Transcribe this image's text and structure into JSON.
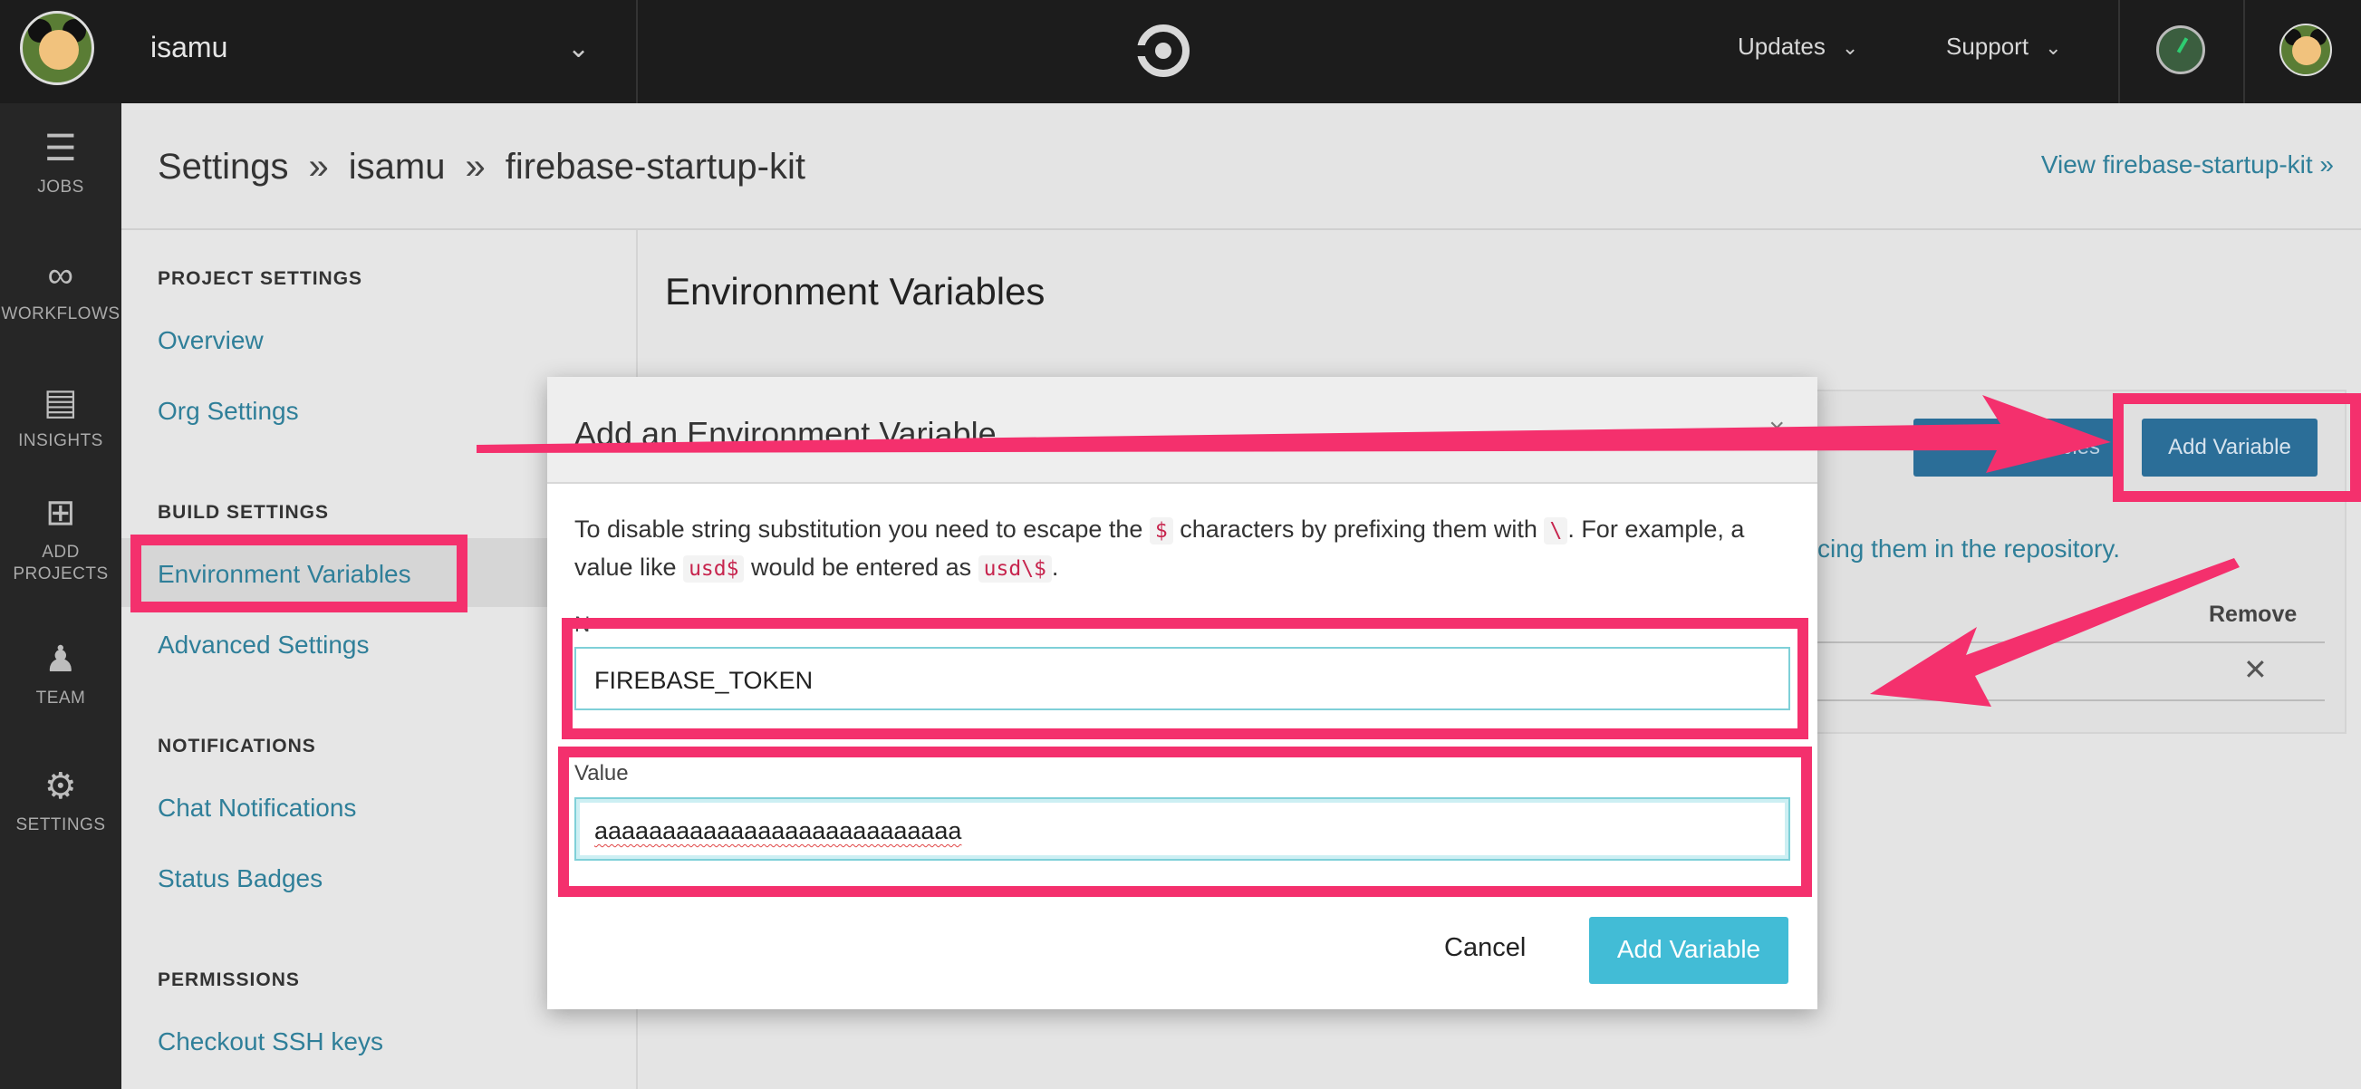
{
  "topbar": {
    "org_name": "isamu",
    "nav_updates": "Updates",
    "nav_support": "Support",
    "icons": [
      "org-avatar",
      "chevron-down-icon",
      "circleci-logo",
      "status-icon",
      "user-avatar"
    ]
  },
  "rail": {
    "items": [
      {
        "label": "JOBS",
        "icon": "jobs-icon"
      },
      {
        "label": "WORKFLOWS",
        "icon": "workflows-icon"
      },
      {
        "label": "INSIGHTS",
        "icon": "insights-icon"
      },
      {
        "label_line1": "ADD",
        "label_line2": "PROJECTS",
        "icon": "add-projects-icon"
      },
      {
        "label": "TEAM",
        "icon": "team-icon"
      },
      {
        "label": "SETTINGS",
        "icon": "settings-icon"
      }
    ]
  },
  "header": {
    "crumb_settings": "Settings",
    "crumb_org": "isamu",
    "crumb_project": "firebase-startup-kit",
    "separator": "»",
    "view_link": "View firebase-startup-kit »"
  },
  "settings_nav": {
    "project_heading": "PROJECT SETTINGS",
    "overview": "Overview",
    "org_settings": "Org Settings",
    "build_heading": "BUILD SETTINGS",
    "env_vars": "Environment Variables",
    "advanced": "Advanced Settings",
    "notif_heading": "NOTIFICATIONS",
    "chat": "Chat Notifications",
    "status": "Status Badges",
    "perm_heading": "PERMISSIONS",
    "ssh": "Checkout SSH keys"
  },
  "main": {
    "title": "Environment Variables",
    "import_button": "Variables",
    "add_button": "Add Variable",
    "partial_text": "cing them in the repository.",
    "remove_header": "Remove",
    "remove_icon": "close-icon"
  },
  "modal": {
    "title": "Add an Environment Variable",
    "desc_part1": "To disable string substitution you need to escape the ",
    "code_dollar": "$",
    "desc_part2": " characters by prefixing them with ",
    "code_backslash": "\\",
    "desc_part3": ". For example, a value like ",
    "code_usd": "usd$",
    "desc_part4": " would be entered as ",
    "code_usd_escaped": "usd\\$",
    "desc_part5": ".",
    "name_label": "N",
    "name_value": "FIREBASE_TOKEN",
    "value_label": "Value",
    "value_value": "aaaaaaaaaaaaaaaaaaaaaaaaaaa",
    "cancel_button": "Cancel",
    "submit_button": "Add Variable"
  },
  "colors": {
    "annotation": "#f4306d",
    "link": "#2f7f99",
    "primary_button": "#42bcd6",
    "topbar": "#1c1c1c"
  }
}
